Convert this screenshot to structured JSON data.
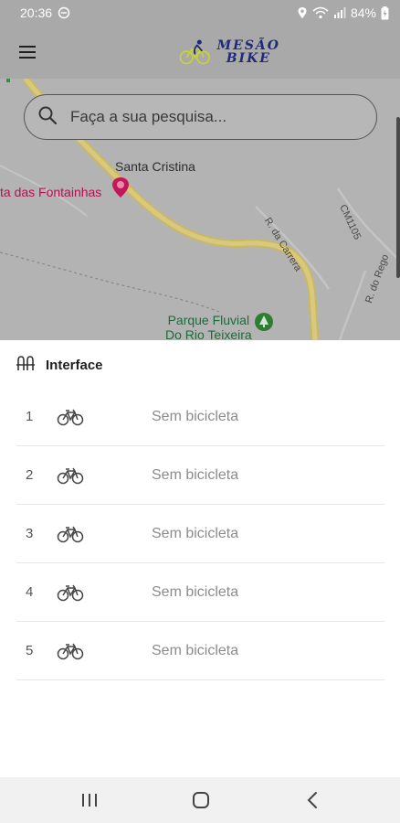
{
  "status_bar": {
    "time": "20:36",
    "battery": "84%",
    "icons": [
      "do-not-disturb-icon",
      "location-icon",
      "wifi-icon",
      "signal-icon",
      "battery-charging-icon"
    ]
  },
  "app_bar": {
    "menu_icon": "hamburger-menu-icon",
    "logo": {
      "line1": "MESÃO",
      "line2": "BIKE",
      "colors": {
        "text": "#1e2a78",
        "bike": "#c8d23a"
      }
    }
  },
  "map": {
    "labels": {
      "santa_cristina": "Santa Cristina",
      "fontainhas": "ta das Fontainhas",
      "r_carrera": "R. da Carrera",
      "cm": "CM1105",
      "rego": "R. do Rego",
      "parque_line1": "Parque Fluvial",
      "parque_line2": "Do Rio Teixeira"
    },
    "search": {
      "placeholder": "Faça a sua pesquisa...",
      "value": ""
    },
    "colors": {
      "road": "#c9b86a",
      "background": "#b3b3b3",
      "poi_pink": "#c2185b",
      "poi_green": "#2e7d32"
    }
  },
  "sheet": {
    "title": "Interface",
    "slots": [
      {
        "number": "1",
        "status": "Sem bicicleta"
      },
      {
        "number": "2",
        "status": "Sem bicicleta"
      },
      {
        "number": "3",
        "status": "Sem bicicleta"
      },
      {
        "number": "4",
        "status": "Sem bicicleta"
      },
      {
        "number": "5",
        "status": "Sem bicicleta"
      }
    ]
  },
  "nav_bar": {
    "buttons": [
      "recent-apps-icon",
      "home-icon",
      "back-icon"
    ]
  }
}
